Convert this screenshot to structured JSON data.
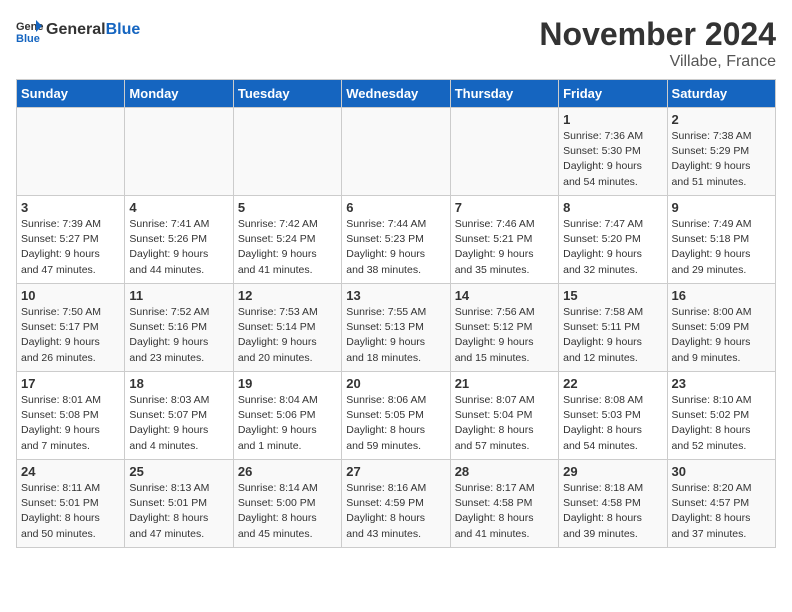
{
  "header": {
    "logo_general": "General",
    "logo_blue": "Blue",
    "title": "November 2024",
    "location": "Villabe, France"
  },
  "days_of_week": [
    "Sunday",
    "Monday",
    "Tuesday",
    "Wednesday",
    "Thursday",
    "Friday",
    "Saturday"
  ],
  "weeks": [
    [
      {
        "day": "",
        "detail": ""
      },
      {
        "day": "",
        "detail": ""
      },
      {
        "day": "",
        "detail": ""
      },
      {
        "day": "",
        "detail": ""
      },
      {
        "day": "",
        "detail": ""
      },
      {
        "day": "1",
        "detail": "Sunrise: 7:36 AM\nSunset: 5:30 PM\nDaylight: 9 hours\nand 54 minutes."
      },
      {
        "day": "2",
        "detail": "Sunrise: 7:38 AM\nSunset: 5:29 PM\nDaylight: 9 hours\nand 51 minutes."
      }
    ],
    [
      {
        "day": "3",
        "detail": "Sunrise: 7:39 AM\nSunset: 5:27 PM\nDaylight: 9 hours\nand 47 minutes."
      },
      {
        "day": "4",
        "detail": "Sunrise: 7:41 AM\nSunset: 5:26 PM\nDaylight: 9 hours\nand 44 minutes."
      },
      {
        "day": "5",
        "detail": "Sunrise: 7:42 AM\nSunset: 5:24 PM\nDaylight: 9 hours\nand 41 minutes."
      },
      {
        "day": "6",
        "detail": "Sunrise: 7:44 AM\nSunset: 5:23 PM\nDaylight: 9 hours\nand 38 minutes."
      },
      {
        "day": "7",
        "detail": "Sunrise: 7:46 AM\nSunset: 5:21 PM\nDaylight: 9 hours\nand 35 minutes."
      },
      {
        "day": "8",
        "detail": "Sunrise: 7:47 AM\nSunset: 5:20 PM\nDaylight: 9 hours\nand 32 minutes."
      },
      {
        "day": "9",
        "detail": "Sunrise: 7:49 AM\nSunset: 5:18 PM\nDaylight: 9 hours\nand 29 minutes."
      }
    ],
    [
      {
        "day": "10",
        "detail": "Sunrise: 7:50 AM\nSunset: 5:17 PM\nDaylight: 9 hours\nand 26 minutes."
      },
      {
        "day": "11",
        "detail": "Sunrise: 7:52 AM\nSunset: 5:16 PM\nDaylight: 9 hours\nand 23 minutes."
      },
      {
        "day": "12",
        "detail": "Sunrise: 7:53 AM\nSunset: 5:14 PM\nDaylight: 9 hours\nand 20 minutes."
      },
      {
        "day": "13",
        "detail": "Sunrise: 7:55 AM\nSunset: 5:13 PM\nDaylight: 9 hours\nand 18 minutes."
      },
      {
        "day": "14",
        "detail": "Sunrise: 7:56 AM\nSunset: 5:12 PM\nDaylight: 9 hours\nand 15 minutes."
      },
      {
        "day": "15",
        "detail": "Sunrise: 7:58 AM\nSunset: 5:11 PM\nDaylight: 9 hours\nand 12 minutes."
      },
      {
        "day": "16",
        "detail": "Sunrise: 8:00 AM\nSunset: 5:09 PM\nDaylight: 9 hours\nand 9 minutes."
      }
    ],
    [
      {
        "day": "17",
        "detail": "Sunrise: 8:01 AM\nSunset: 5:08 PM\nDaylight: 9 hours\nand 7 minutes."
      },
      {
        "day": "18",
        "detail": "Sunrise: 8:03 AM\nSunset: 5:07 PM\nDaylight: 9 hours\nand 4 minutes."
      },
      {
        "day": "19",
        "detail": "Sunrise: 8:04 AM\nSunset: 5:06 PM\nDaylight: 9 hours\nand 1 minute."
      },
      {
        "day": "20",
        "detail": "Sunrise: 8:06 AM\nSunset: 5:05 PM\nDaylight: 8 hours\nand 59 minutes."
      },
      {
        "day": "21",
        "detail": "Sunrise: 8:07 AM\nSunset: 5:04 PM\nDaylight: 8 hours\nand 57 minutes."
      },
      {
        "day": "22",
        "detail": "Sunrise: 8:08 AM\nSunset: 5:03 PM\nDaylight: 8 hours\nand 54 minutes."
      },
      {
        "day": "23",
        "detail": "Sunrise: 8:10 AM\nSunset: 5:02 PM\nDaylight: 8 hours\nand 52 minutes."
      }
    ],
    [
      {
        "day": "24",
        "detail": "Sunrise: 8:11 AM\nSunset: 5:01 PM\nDaylight: 8 hours\nand 50 minutes."
      },
      {
        "day": "25",
        "detail": "Sunrise: 8:13 AM\nSunset: 5:01 PM\nDaylight: 8 hours\nand 47 minutes."
      },
      {
        "day": "26",
        "detail": "Sunrise: 8:14 AM\nSunset: 5:00 PM\nDaylight: 8 hours\nand 45 minutes."
      },
      {
        "day": "27",
        "detail": "Sunrise: 8:16 AM\nSunset: 4:59 PM\nDaylight: 8 hours\nand 43 minutes."
      },
      {
        "day": "28",
        "detail": "Sunrise: 8:17 AM\nSunset: 4:58 PM\nDaylight: 8 hours\nand 41 minutes."
      },
      {
        "day": "29",
        "detail": "Sunrise: 8:18 AM\nSunset: 4:58 PM\nDaylight: 8 hours\nand 39 minutes."
      },
      {
        "day": "30",
        "detail": "Sunrise: 8:20 AM\nSunset: 4:57 PM\nDaylight: 8 hours\nand 37 minutes."
      }
    ]
  ]
}
